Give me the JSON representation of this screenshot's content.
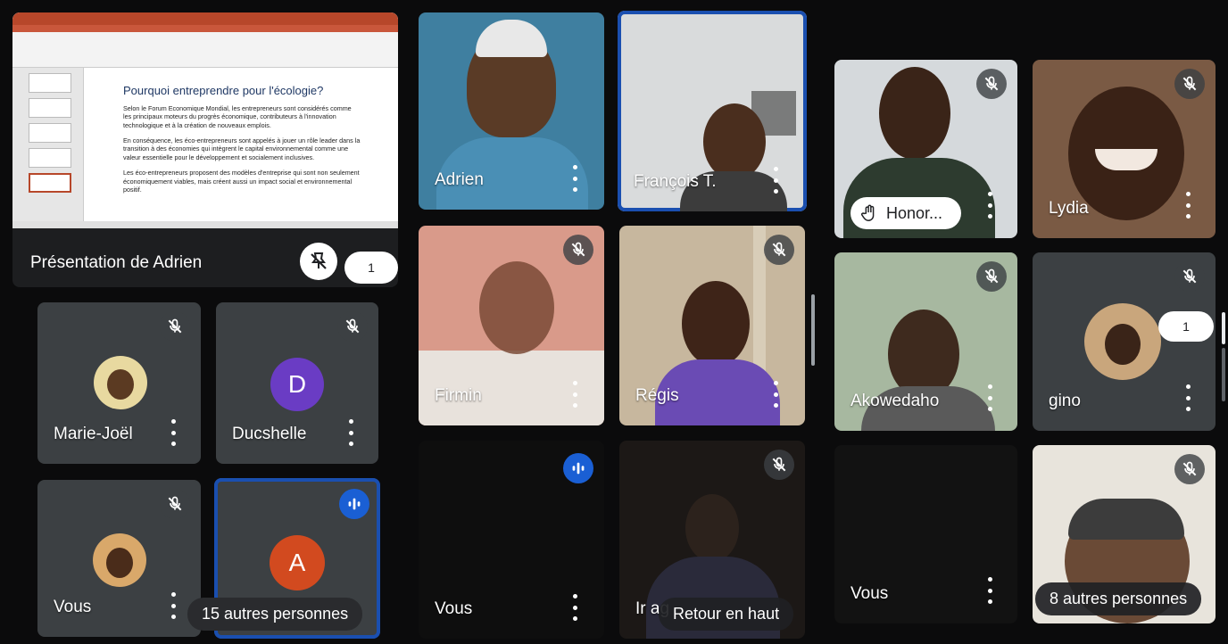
{
  "presentation": {
    "label": "Présentation de Adrien",
    "count": "1",
    "slide": {
      "title": "Pourquoi entreprendre pour l'écologie?",
      "bullets": [
        "Selon le Forum Economique Mondial, les entrepreneurs sont considérés comme les principaux moteurs du progrès économique, contributeurs à l'innovation technologique et à la création de nouveaux emplois.",
        "En conséquence, les éco-entrepreneurs sont appelés à jouer un rôle leader dans la transition à des économies qui intègrent le capital environnemental comme une valeur essentielle pour le développement et socialement inclusives.",
        "Les éco-entrepreneurs proposent des modèles d'entreprise qui sont non seulement économiquement viables, mais créent aussi un impact social et environnemental positif."
      ]
    }
  },
  "left_tiles": [
    {
      "name": "Marie-Joël"
    },
    {
      "name": "Ducshelle",
      "initial": "D"
    },
    {
      "name": "Vous"
    },
    {
      "name": "",
      "initial": "A"
    }
  ],
  "left_more": "15 autres personnes",
  "mid_tiles": [
    {
      "name": "Adrien"
    },
    {
      "name": "François T."
    },
    {
      "name": "Firmin"
    },
    {
      "name": "Régis"
    },
    {
      "name": "Vous"
    },
    {
      "name": "Ir ag"
    }
  ],
  "back_to_top": "Retour en haut",
  "right_tiles": [
    {
      "name": "Honor..."
    },
    {
      "name": "Lydia"
    },
    {
      "name": "Akowedaho"
    },
    {
      "name": "gino",
      "count": "1"
    },
    {
      "name": "Vous"
    },
    {
      "name": ""
    }
  ],
  "right_more": "8 autres personnes",
  "colors": {
    "accent": "#1a5fd4",
    "avatar_d": "#6a3cc4",
    "avatar_a": "#d24a1f"
  }
}
